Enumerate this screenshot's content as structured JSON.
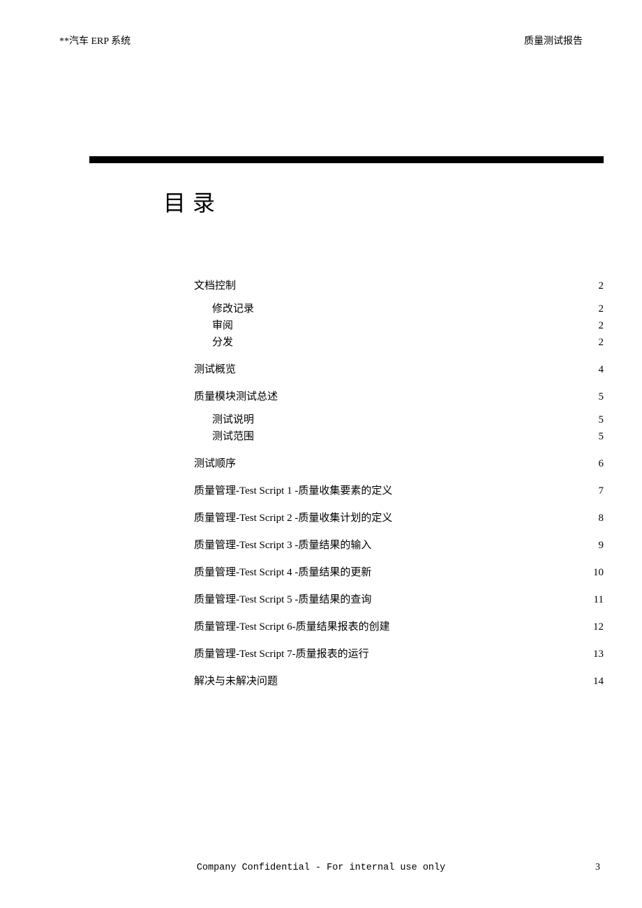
{
  "header": {
    "left": "**汽车 ERP 系统",
    "right": "质量测试报告"
  },
  "toc": {
    "title": "目录",
    "entries": [
      {
        "level": 1,
        "label": "文档控制",
        "page": "2"
      },
      {
        "level": 2,
        "label": "修改记录",
        "page": "2",
        "firstSub": true
      },
      {
        "level": 2,
        "label": "审阅",
        "page": "2"
      },
      {
        "level": 2,
        "label": "分发",
        "page": "2"
      },
      {
        "level": 1,
        "label": "测试概览",
        "page": "4"
      },
      {
        "level": 1,
        "label": "质量模块测试总述",
        "page": "5"
      },
      {
        "level": 2,
        "label": "测试说明",
        "page": "5",
        "firstSub": true
      },
      {
        "level": 2,
        "label": "测试范围",
        "page": "5"
      },
      {
        "level": 1,
        "label": "测试顺序",
        "page": "6"
      },
      {
        "level": 1,
        "label": "质量管理-Test Script 1 -质量收集要素的定义",
        "page": "7"
      },
      {
        "level": 1,
        "label": "质量管理-Test Script 2 -质量收集计划的定义",
        "page": "8"
      },
      {
        "level": 1,
        "label": "质量管理-Test Script 3 -质量结果的输入",
        "page": "9"
      },
      {
        "level": 1,
        "label": "质量管理-Test Script 4 -质量结果的更新",
        "page": "10"
      },
      {
        "level": 1,
        "label": "质量管理-Test Script 5 -质量结果的查询",
        "page": "11"
      },
      {
        "level": 1,
        "label": "质量管理-Test Script 6-质量结果报表的创建",
        "page": "12"
      },
      {
        "level": 1,
        "label": "质量管理-Test Script 7-质量报表的运行",
        "page": "13"
      },
      {
        "level": 1,
        "label": "解决与未解决问题",
        "page": "14"
      }
    ]
  },
  "footer": {
    "text": "Company Confidential - For internal use only",
    "page_number": "3"
  }
}
